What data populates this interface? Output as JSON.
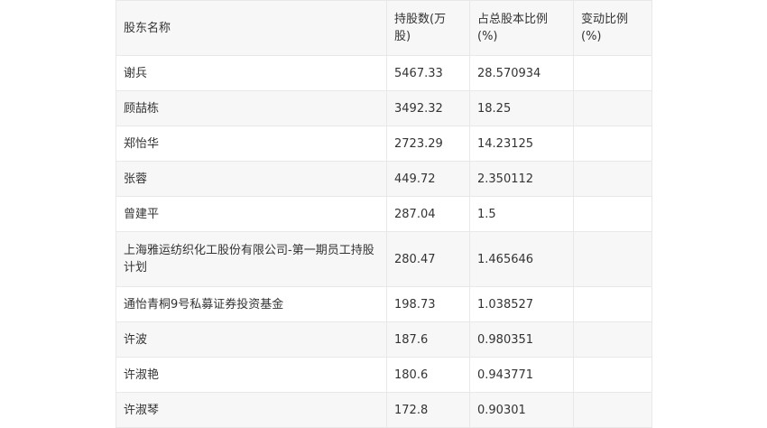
{
  "table": {
    "headers": [
      "股东名称",
      "持股数(万股)",
      "占总股本比例(%)",
      "变动比例(%)"
    ],
    "rows": [
      {
        "name": "谢兵",
        "shares": "5467.33",
        "ratio": "28.570934",
        "change": ""
      },
      {
        "name": "顾喆栋",
        "shares": "3492.32",
        "ratio": "18.25",
        "change": ""
      },
      {
        "name": "郑怡华",
        "shares": "2723.29",
        "ratio": "14.23125",
        "change": ""
      },
      {
        "name": "张蓉",
        "shares": "449.72",
        "ratio": "2.350112",
        "change": ""
      },
      {
        "name": "曾建平",
        "shares": "287.04",
        "ratio": "1.5",
        "change": ""
      },
      {
        "name": "上海雅运纺织化工股份有限公司-第一期员工持股计划",
        "shares": "280.47",
        "ratio": "1.465646",
        "change": ""
      },
      {
        "name": "通怡青桐9号私募证券投资基金",
        "shares": "198.73",
        "ratio": "1.038527",
        "change": ""
      },
      {
        "name": "许波",
        "shares": "187.6",
        "ratio": "0.980351",
        "change": ""
      },
      {
        "name": "许淑艳",
        "shares": "180.6",
        "ratio": "0.943771",
        "change": ""
      },
      {
        "name": "许淑琴",
        "shares": "172.8",
        "ratio": "0.90301",
        "change": ""
      }
    ]
  }
}
